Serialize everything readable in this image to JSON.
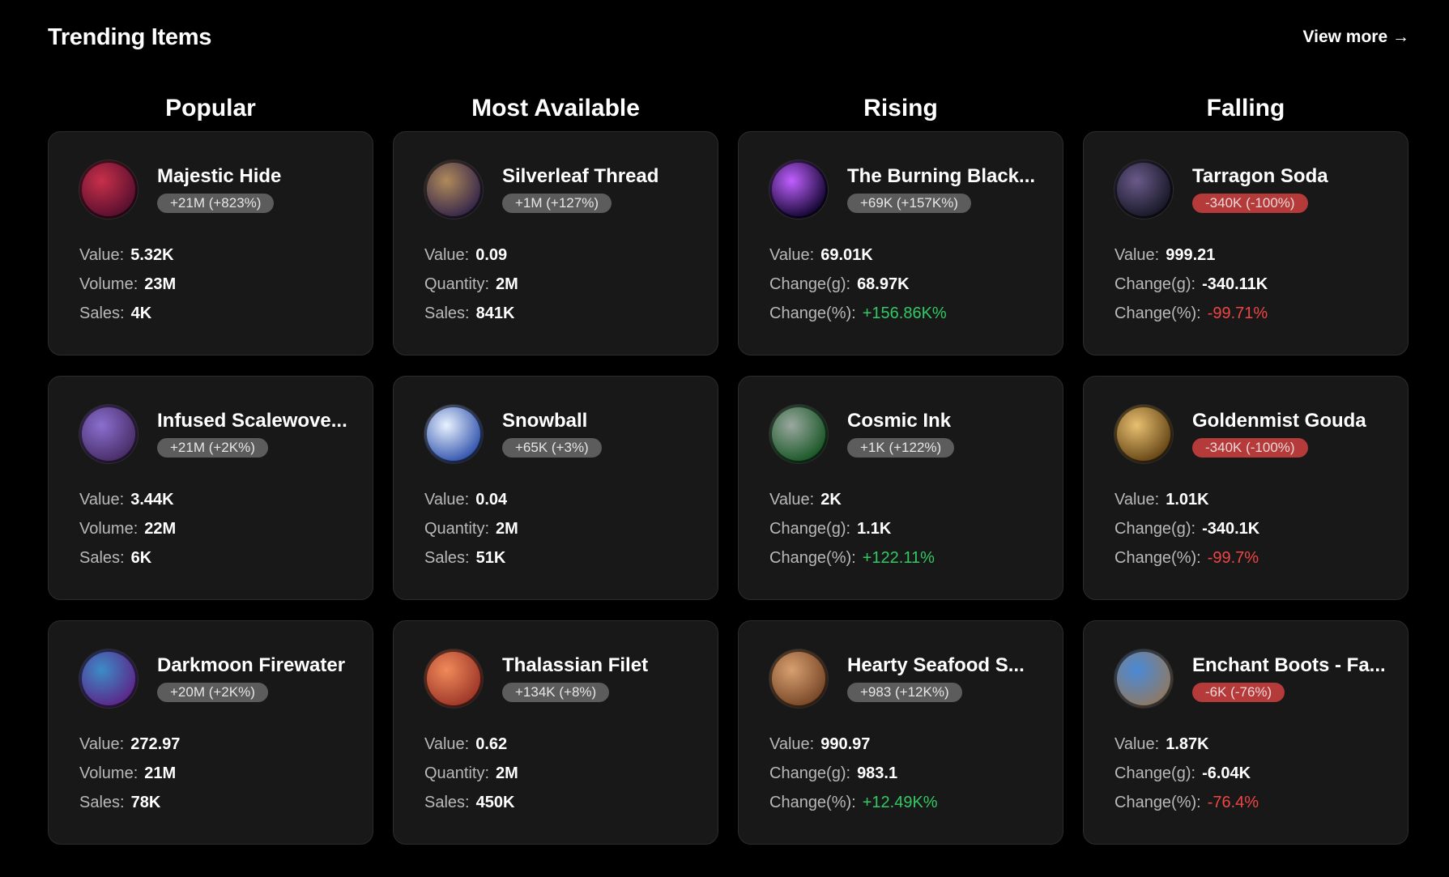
{
  "header": {
    "title": "Trending Items",
    "view_more": "View more →"
  },
  "columns": [
    {
      "title": "Popular",
      "items": [
        {
          "name": "Majestic Hide",
          "badge": "+21M (+823%)",
          "badge_kind": "neutral",
          "icon": "red-hide-icon",
          "colors": [
            "#c8304a",
            "#5b1030"
          ],
          "stats": [
            {
              "label": "Value:",
              "value": "5.32K",
              "kind": "plain"
            },
            {
              "label": "Volume:",
              "value": "23M",
              "kind": "plain"
            },
            {
              "label": "Sales:",
              "value": "4K",
              "kind": "plain"
            }
          ]
        },
        {
          "name": "Infused Scalewove...",
          "badge": "+21M (+2K%)",
          "badge_kind": "neutral",
          "icon": "purple-scale-icon",
          "colors": [
            "#8a6fd0",
            "#4a2f6a"
          ],
          "stats": [
            {
              "label": "Value:",
              "value": "3.44K",
              "kind": "plain"
            },
            {
              "label": "Volume:",
              "value": "22M",
              "kind": "plain"
            },
            {
              "label": "Sales:",
              "value": "6K",
              "kind": "plain"
            }
          ]
        },
        {
          "name": "Darkmoon Firewater",
          "badge": "+20M (+2K%)",
          "badge_kind": "neutral",
          "icon": "purple-potion-icon",
          "colors": [
            "#3c8cc8",
            "#5a2a8a"
          ],
          "stats": [
            {
              "label": "Value:",
              "value": "272.97",
              "kind": "plain"
            },
            {
              "label": "Volume:",
              "value": "21M",
              "kind": "plain"
            },
            {
              "label": "Sales:",
              "value": "78K",
              "kind": "plain"
            }
          ]
        }
      ]
    },
    {
      "title": "Most Available",
      "items": [
        {
          "name": "Silverleaf Thread",
          "badge": "+1M (+127%)",
          "badge_kind": "neutral",
          "icon": "thread-spool-icon",
          "colors": [
            "#b08a5a",
            "#3a2a4a"
          ],
          "stats": [
            {
              "label": "Value:",
              "value": "0.09",
              "kind": "plain"
            },
            {
              "label": "Quantity:",
              "value": "2M",
              "kind": "plain"
            },
            {
              "label": "Sales:",
              "value": "841K",
              "kind": "plain"
            }
          ]
        },
        {
          "name": "Snowball",
          "badge": "+65K (+3%)",
          "badge_kind": "neutral",
          "icon": "snowball-icon",
          "colors": [
            "#e8f2ff",
            "#3a5ab0"
          ],
          "stats": [
            {
              "label": "Value:",
              "value": "0.04",
              "kind": "plain"
            },
            {
              "label": "Quantity:",
              "value": "2M",
              "kind": "plain"
            },
            {
              "label": "Sales:",
              "value": "51K",
              "kind": "plain"
            }
          ]
        },
        {
          "name": "Thalassian Filet",
          "badge": "+134K (+8%)",
          "badge_kind": "neutral",
          "icon": "meat-filet-icon",
          "colors": [
            "#f08a5a",
            "#a03a2a"
          ],
          "stats": [
            {
              "label": "Value:",
              "value": "0.62",
              "kind": "plain"
            },
            {
              "label": "Quantity:",
              "value": "2M",
              "kind": "plain"
            },
            {
              "label": "Sales:",
              "value": "450K",
              "kind": "plain"
            }
          ]
        }
      ]
    },
    {
      "title": "Rising",
      "items": [
        {
          "name": "The Burning Black...",
          "badge": "+69K (+157K%)",
          "badge_kind": "neutral",
          "icon": "purple-flame-icon",
          "colors": [
            "#c060ff",
            "#1a0a3a"
          ],
          "stats": [
            {
              "label": "Value:",
              "value": "69.01K",
              "kind": "plain"
            },
            {
              "label": "Change(g):",
              "value": "68.97K",
              "kind": "plain"
            },
            {
              "label": "Change(%):",
              "value": "+156.86K%",
              "kind": "pos"
            }
          ]
        },
        {
          "name": "Cosmic Ink",
          "badge": "+1K (+122%)",
          "badge_kind": "neutral",
          "icon": "ink-jar-icon",
          "colors": [
            "#9aa8a0",
            "#1e5a2a"
          ],
          "stats": [
            {
              "label": "Value:",
              "value": "2K",
              "kind": "plain"
            },
            {
              "label": "Change(g):",
              "value": "1.1K",
              "kind": "plain"
            },
            {
              "label": "Change(%):",
              "value": "+122.11%",
              "kind": "pos"
            }
          ]
        },
        {
          "name": "Hearty Seafood S...",
          "badge": "+983 (+12K%)",
          "badge_kind": "neutral",
          "icon": "seafood-bowl-icon",
          "colors": [
            "#d8a070",
            "#7a4a2a"
          ],
          "stats": [
            {
              "label": "Value:",
              "value": "990.97",
              "kind": "plain"
            },
            {
              "label": "Change(g):",
              "value": "983.1",
              "kind": "plain"
            },
            {
              "label": "Change(%):",
              "value": "+12.49K%",
              "kind": "pos"
            }
          ]
        }
      ]
    },
    {
      "title": "Falling",
      "items": [
        {
          "name": "Tarragon Soda",
          "badge": "-340K (-100%)",
          "badge_kind": "neg",
          "icon": "soda-mug-icon",
          "colors": [
            "#6a5a8a",
            "#1a1a2a"
          ],
          "stats": [
            {
              "label": "Value:",
              "value": "999.21",
              "kind": "plain"
            },
            {
              "label": "Change(g):",
              "value": "-340.11K",
              "kind": "plain"
            },
            {
              "label": "Change(%):",
              "value": "-99.71%",
              "kind": "neg"
            }
          ]
        },
        {
          "name": "Goldenmist Gouda",
          "badge": "-340K (-100%)",
          "badge_kind": "neg",
          "icon": "cheese-wedge-icon",
          "colors": [
            "#e8c070",
            "#6a4a1a"
          ],
          "stats": [
            {
              "label": "Value:",
              "value": "1.01K",
              "kind": "plain"
            },
            {
              "label": "Change(g):",
              "value": "-340.1K",
              "kind": "plain"
            },
            {
              "label": "Change(%):",
              "value": "-99.7%",
              "kind": "neg"
            }
          ]
        },
        {
          "name": "Enchant Boots - Fa...",
          "badge": "-6K (-76%)",
          "badge_kind": "neg",
          "icon": "enchant-scroll-icon",
          "colors": [
            "#4a8ad8",
            "#8a7a6a"
          ],
          "stats": [
            {
              "label": "Value:",
              "value": "1.87K",
              "kind": "plain"
            },
            {
              "label": "Change(g):",
              "value": "-6.04K",
              "kind": "plain"
            },
            {
              "label": "Change(%):",
              "value": "-76.4%",
              "kind": "neg"
            }
          ]
        }
      ]
    }
  ]
}
